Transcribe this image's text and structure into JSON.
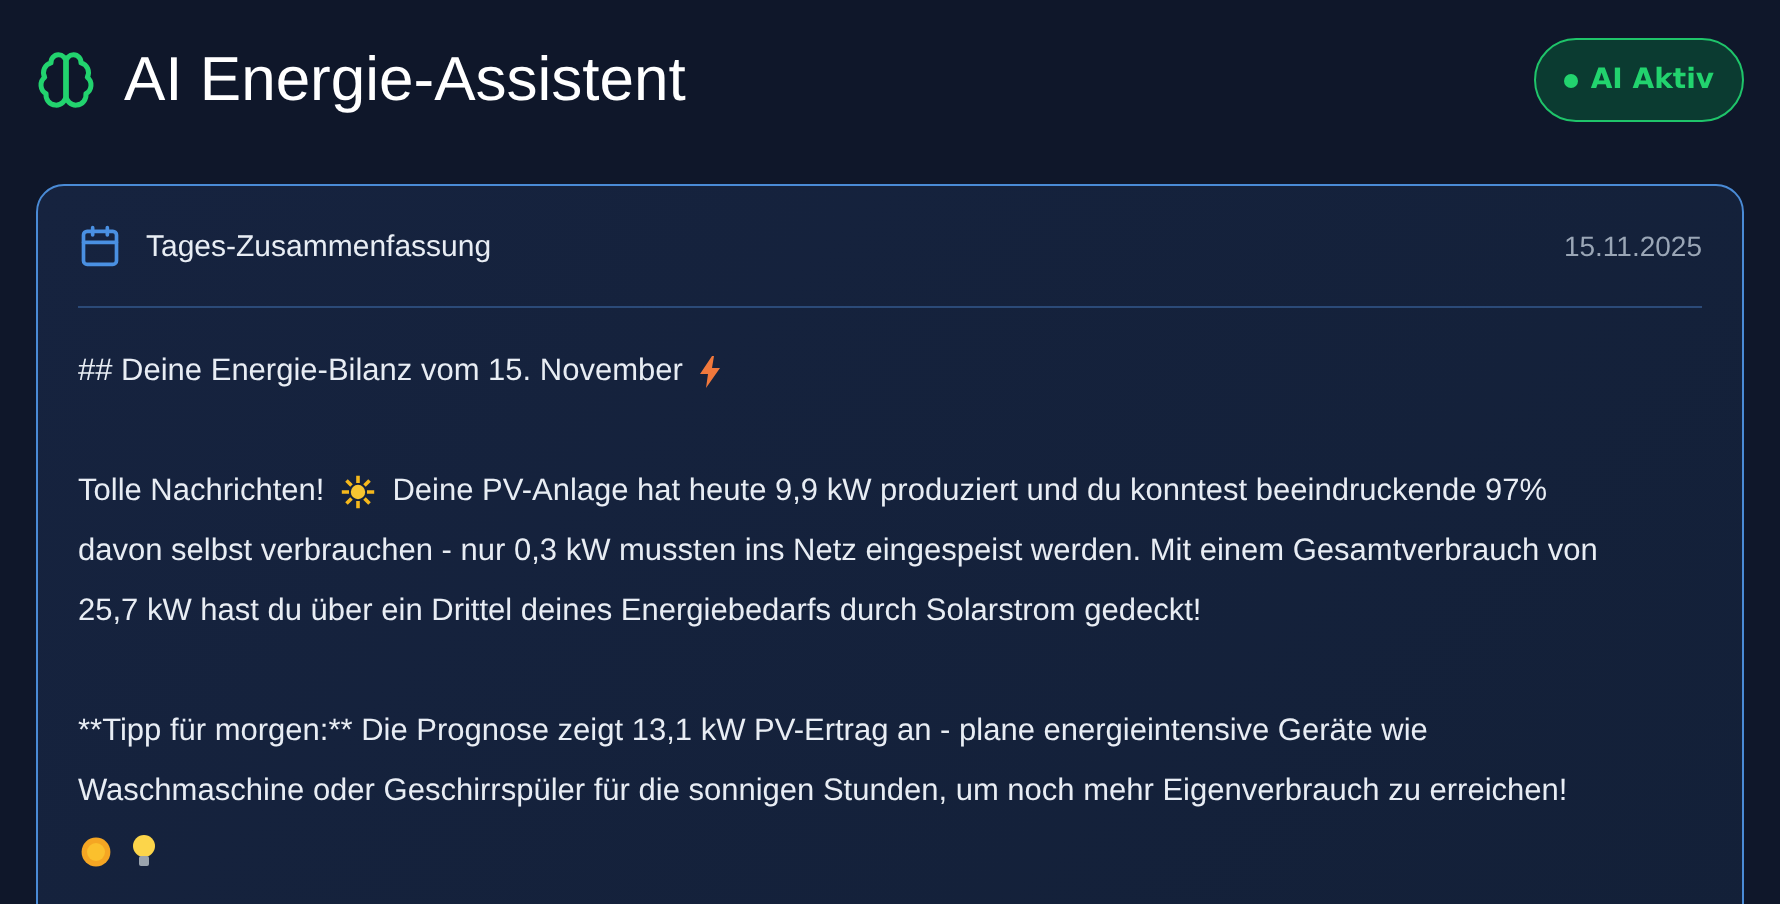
{
  "header": {
    "title": "AI Energie-Assistent",
    "status": {
      "label": "AI Aktiv",
      "on": true
    }
  },
  "card": {
    "title": "Tages-Zusammenfassung",
    "date": "15.11.2025",
    "heading": "## Deine Energie-Bilanz vom 15. November",
    "intro": {
      "greeting": "Tolle Nachrichten!",
      "first_line": "Deine PV-Anlage hat heute 9,9 kW produziert und du konntest beeindruckende 97%",
      "rest": "davon selbst verbrauchen - nur 0,3 kW mussten ins Netz eingespeist werden. Mit einem Gesamtverbrauch von 25,7 kW hast du über ein Drittel deines Energiebedarfs durch Solarstrom gedeckt!"
    },
    "tip": "**Tipp für morgen:** Die Prognose zeigt 13,1 kW PV-Ertrag an - plane energieintensive Geräte wie Waschmaschine oder Geschirrspüler für die sonnigen Stunden, um noch mehr Eigenverbrauch zu erreichen!"
  }
}
